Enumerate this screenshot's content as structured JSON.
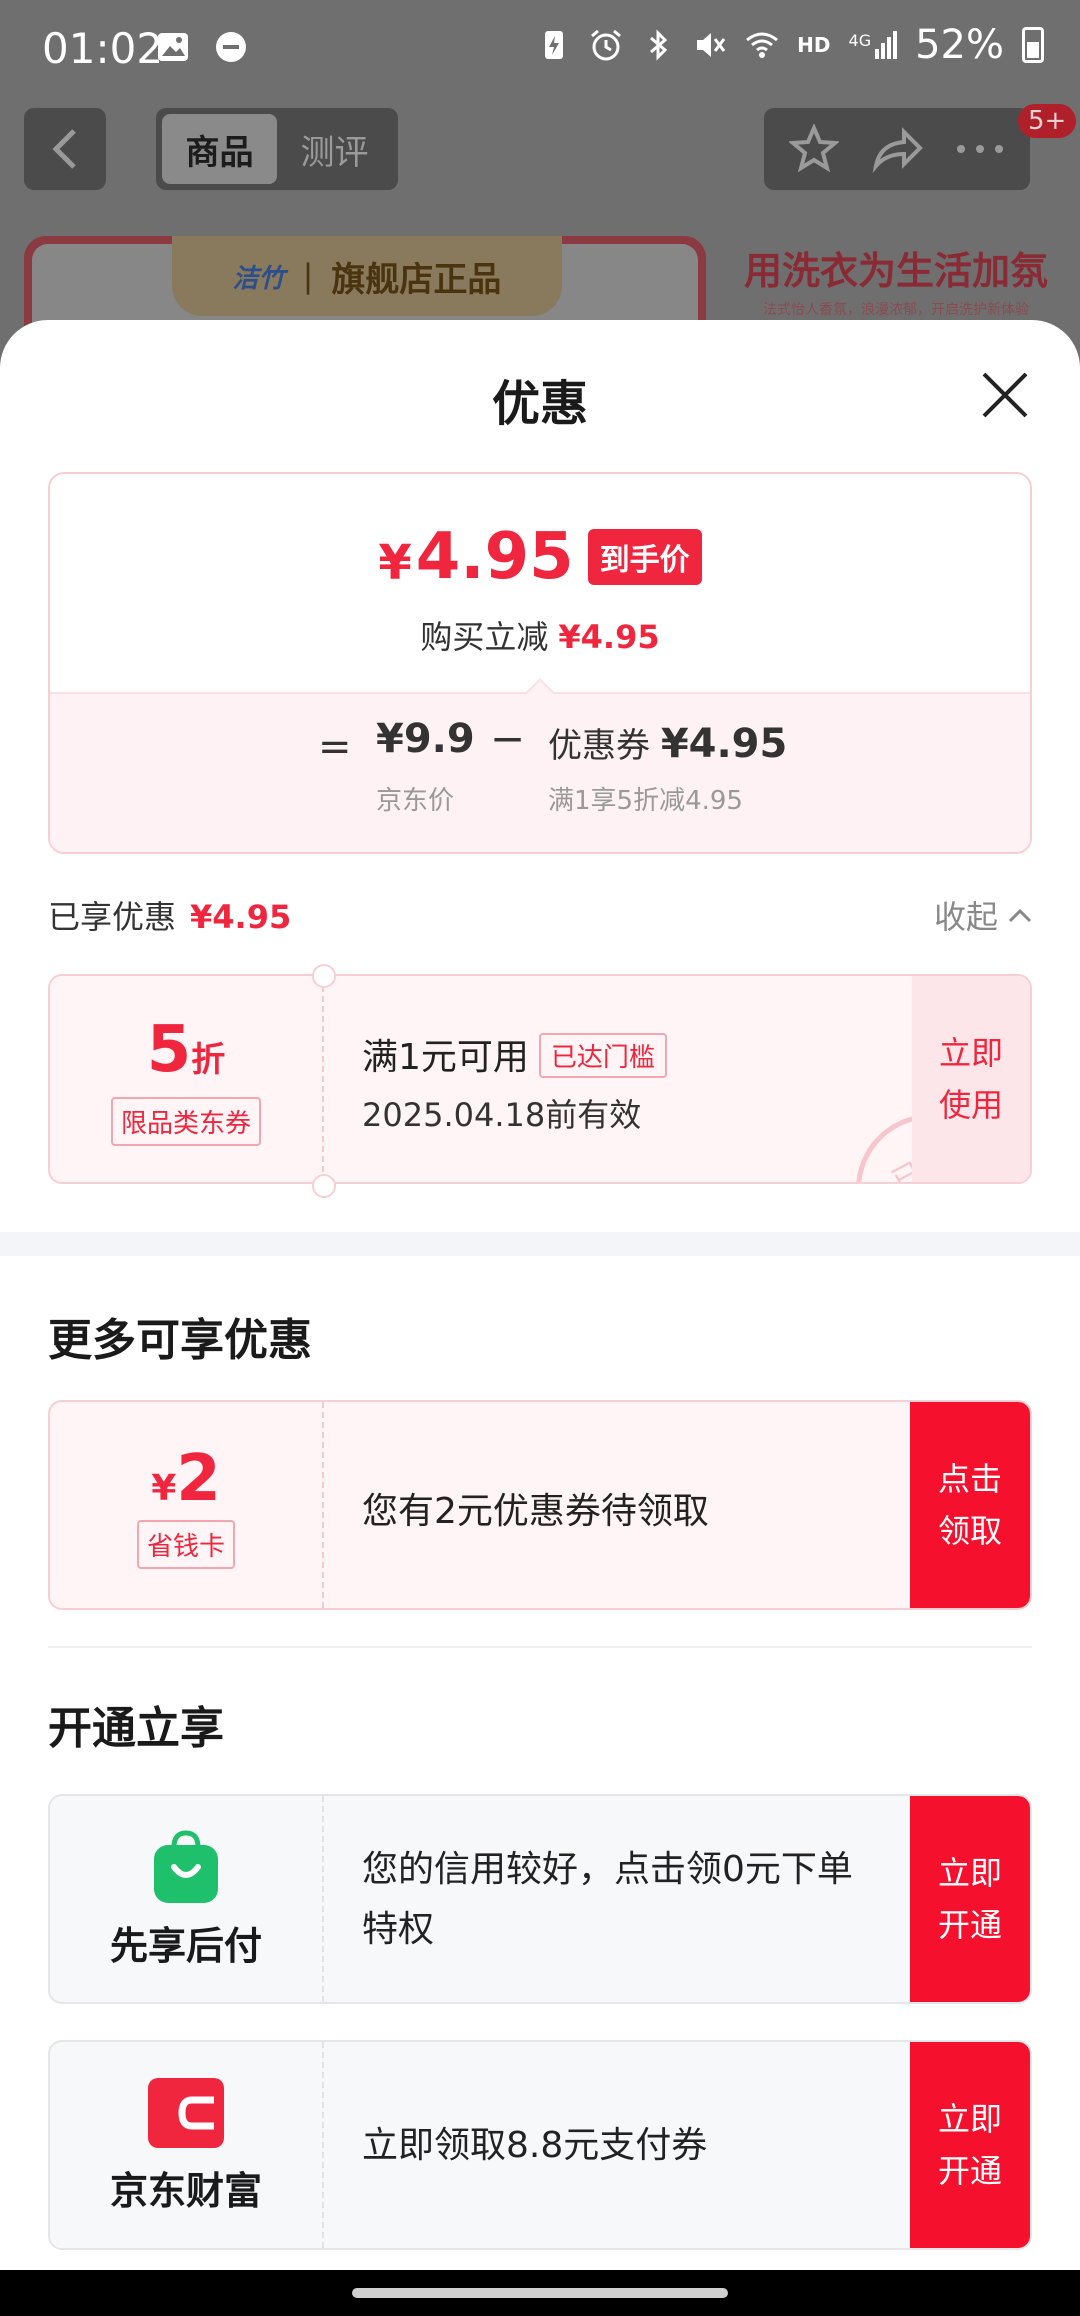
{
  "status_bar": {
    "time": "01:02",
    "battery": "52%",
    "network": "4G",
    "hd": "HD"
  },
  "background_page": {
    "tabs": [
      "商品",
      "测评"
    ],
    "active_tab": "商品",
    "badge": "5+",
    "banner_tag": "旗舰店正品",
    "banner_logo": "洁竹",
    "banner_headline": "用洗衣为生活加氛",
    "banner_subline": "法式怡人香氛，浪漫浓郁，开启洗护新体验"
  },
  "sheet": {
    "title": "优惠",
    "price_summary": {
      "currency": "¥",
      "final_price": "4.95",
      "final_tag": "到手价",
      "reduction_label": "购买立减",
      "reduction_value": "¥4.95",
      "eq": "=",
      "jd_price": "¥9.9",
      "jd_price_label": "京东价",
      "minus": "−",
      "coupon_label": "优惠券",
      "coupon_value": "¥4.95",
      "coupon_rule": "满1享5折减4.95"
    },
    "enjoyed": {
      "label": "已享优惠",
      "value": "¥4.95",
      "collapse": "收起"
    },
    "applied_coupon": {
      "discount_num": "5",
      "discount_unit": "折",
      "type": "限品类东券",
      "condition": "满1元可用",
      "reached_tag": "已达门槛",
      "validity": "2025.04.18前有效",
      "action_line1": "立即",
      "action_line2": "使用",
      "stamp": "已领"
    },
    "more_section": {
      "title": "更多可享优惠",
      "card": {
        "currency": "¥",
        "amount": "2",
        "type": "省钱卡",
        "desc": "您有2元优惠券待领取",
        "action_line1": "点击",
        "action_line2": "领取"
      }
    },
    "open_section": {
      "title": "开通立享",
      "items": [
        {
          "name": "先享后付",
          "desc": "您的信用较好，点击领0元下单特权",
          "action_line1": "立即",
          "action_line2": "开通",
          "icon": "shopping-bag-icon",
          "color": "#1fc06b"
        },
        {
          "name": "京东财富",
          "desc": "立即领取8.8元支付券",
          "action_line1": "立即",
          "action_line2": "开通",
          "icon": "wallet-icon",
          "color": "#f0263e"
        }
      ]
    }
  },
  "colors": {
    "accent_red": "#f0263e",
    "button_red": "#f5102e",
    "green": "#1fc06b"
  }
}
